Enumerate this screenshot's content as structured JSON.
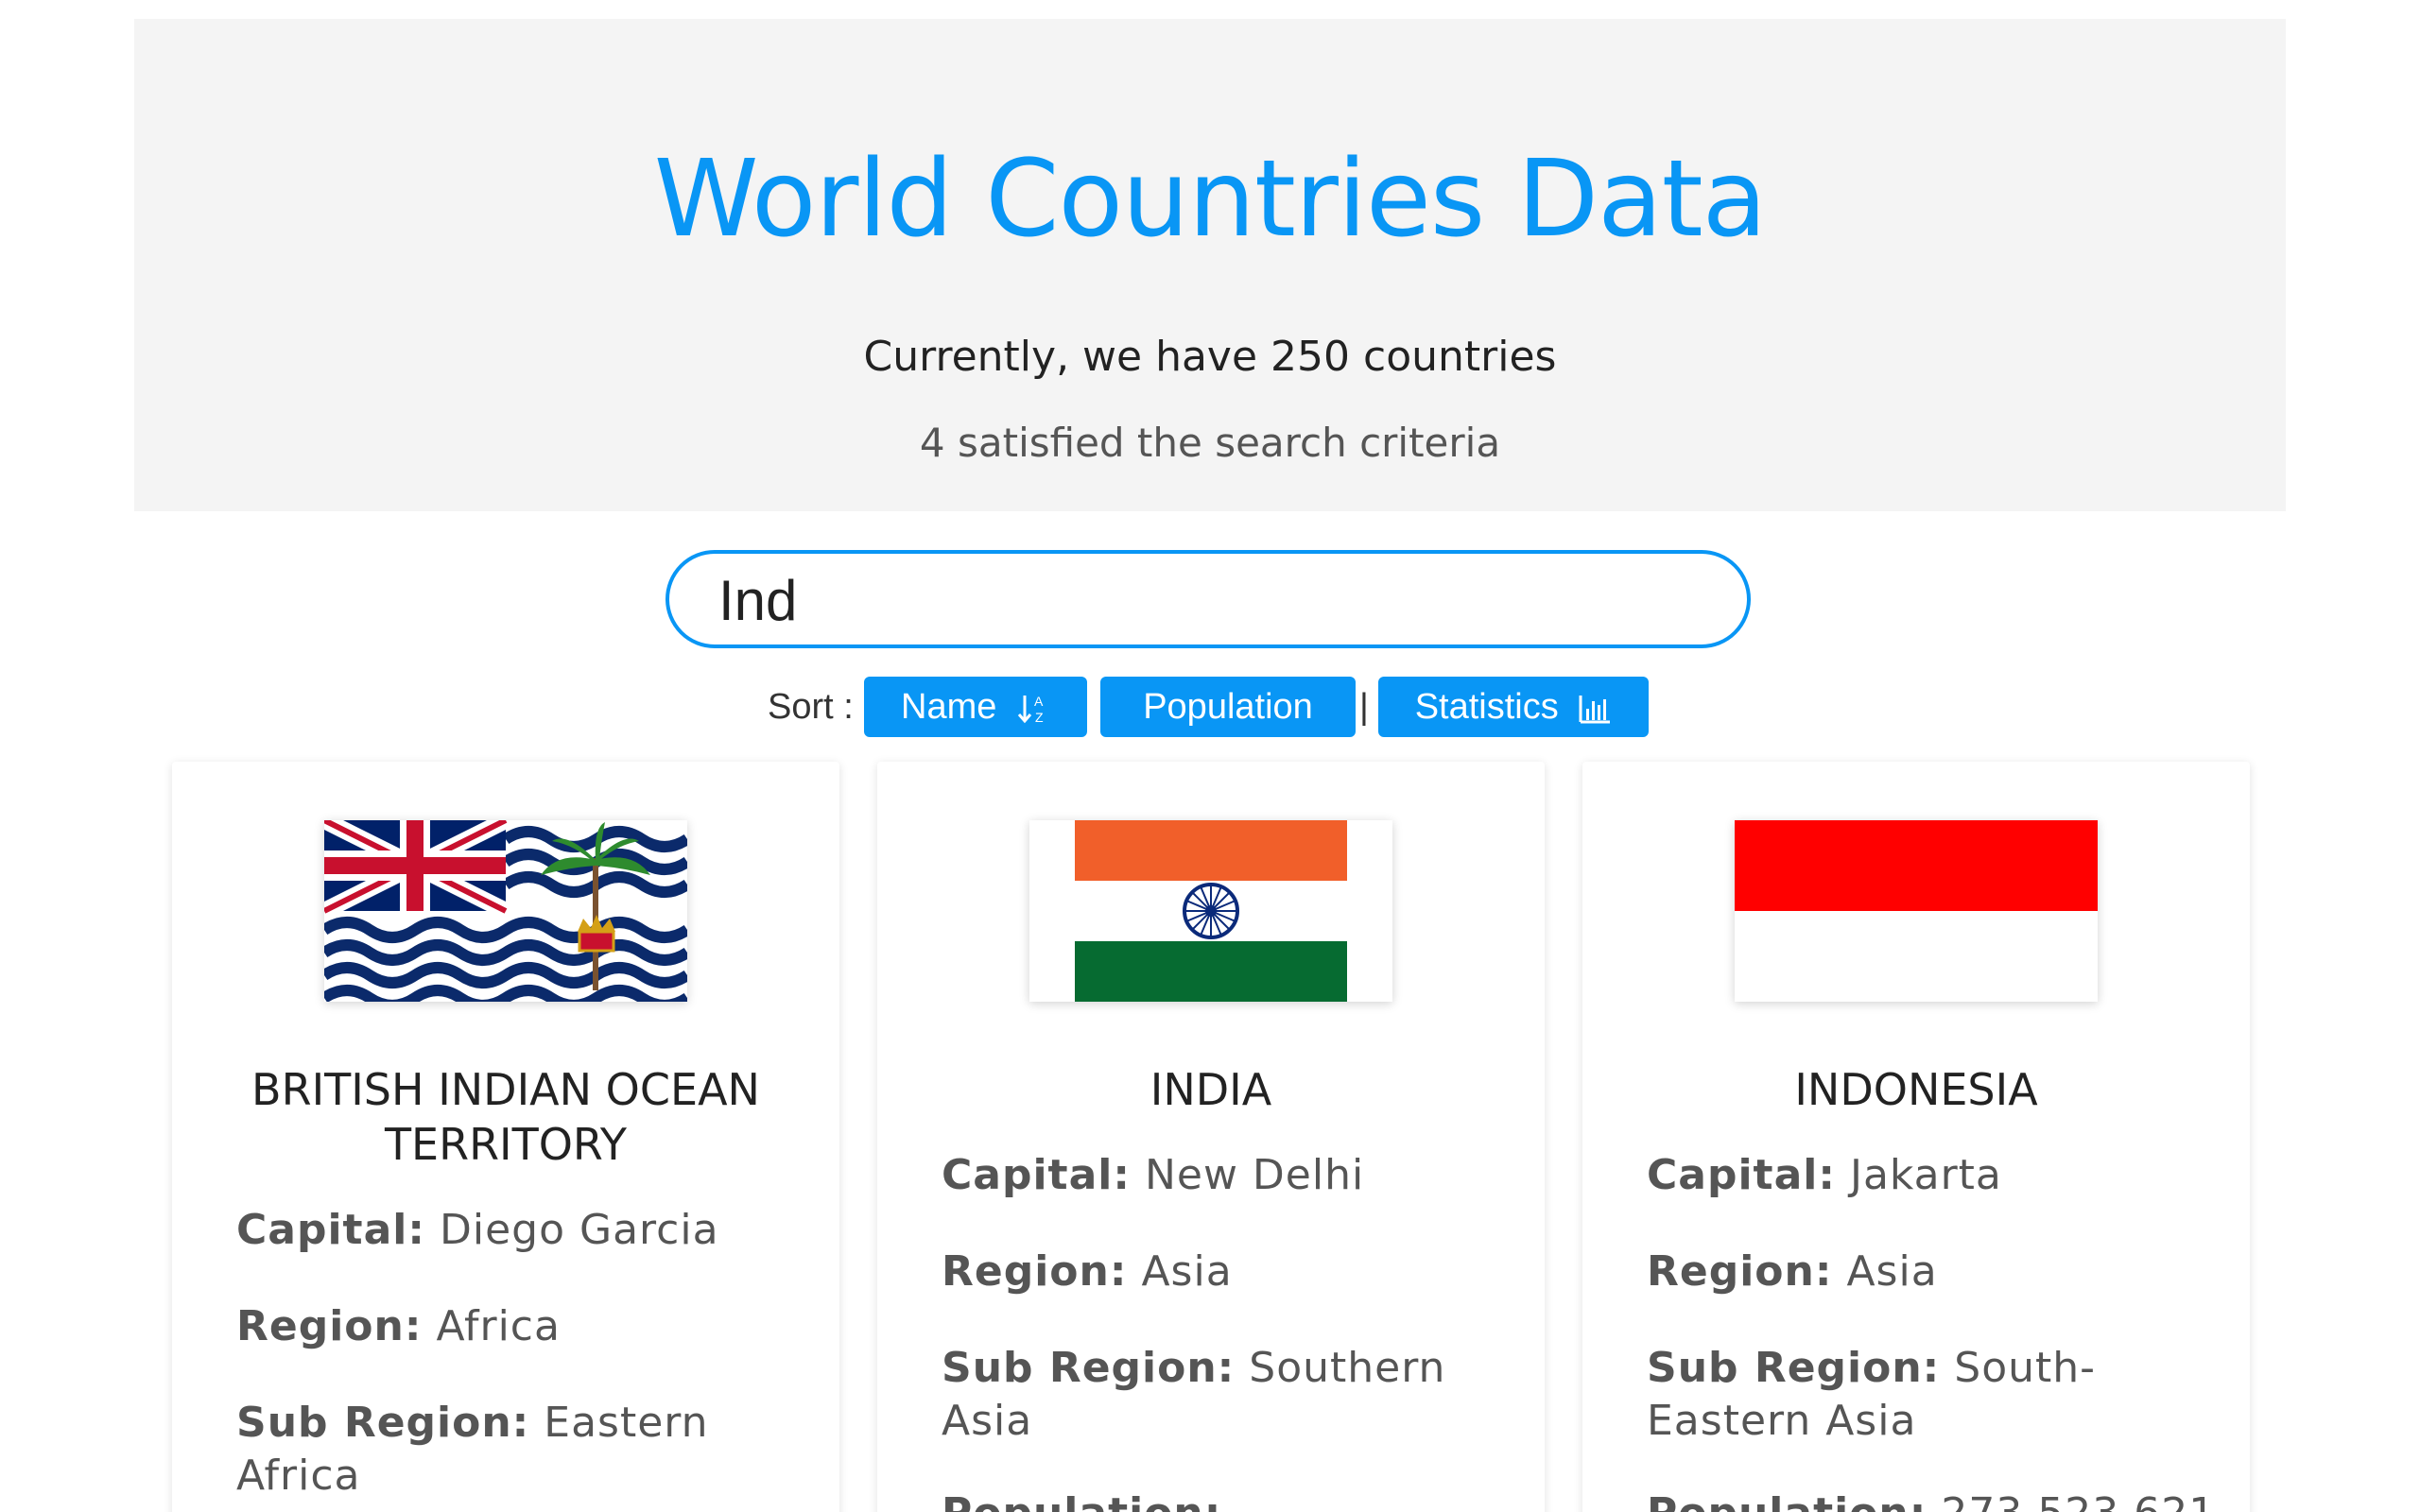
{
  "header": {
    "title": "World Countries Data",
    "count_text": "Currently, we have 250 countries",
    "satisfied_text": "4 satisfied the search criteria"
  },
  "search": {
    "value": "Ind"
  },
  "sort": {
    "label": "Sort :",
    "separator": "|",
    "buttons": [
      {
        "label": "Name",
        "icon": "sort-alpha-down-icon"
      },
      {
        "label": "Population"
      },
      {
        "label": "Statistics",
        "icon": "bar-chart-icon"
      }
    ]
  },
  "labels": {
    "capital": "Capital:",
    "region": "Region:",
    "sub_region": "Sub Region:",
    "population": "Population:"
  },
  "cards": [
    {
      "name": "BRITISH INDIAN OCEAN TERRITORY",
      "flag": "british-indian-ocean-territory-flag",
      "capital": "Diego Garcia",
      "region": "Africa",
      "sub_region": "Eastern Africa"
    },
    {
      "name": "INDIA",
      "flag": "india-flag",
      "capital": "New Delhi",
      "region": "Asia",
      "sub_region": "Southern Asia"
    },
    {
      "name": "INDONESIA",
      "flag": "indonesia-flag",
      "capital": "Jakarta",
      "region": "Asia",
      "sub_region": "South-Eastern Asia",
      "population": "273,523,621"
    }
  ],
  "colors": {
    "accent": "#0996f5",
    "header_bg": "#f4f4f4"
  }
}
